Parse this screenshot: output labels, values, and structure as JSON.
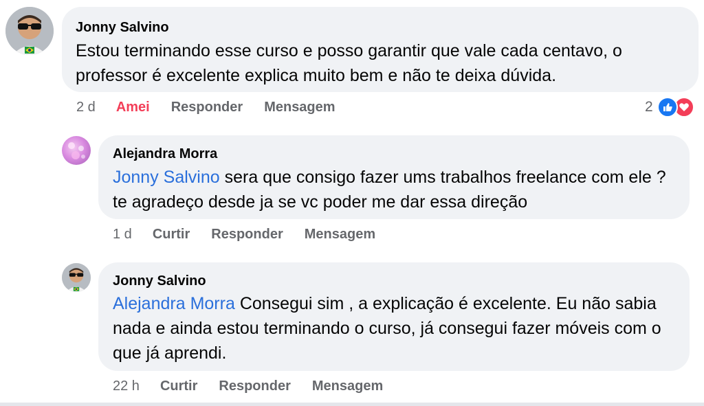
{
  "comments": [
    {
      "author": "Jonny Salvino",
      "text": "Estou terminando esse curso e posso garantir que vale cada centavo, o professor é excelente explica muito bem e não te deixa dúvida.",
      "time": "2 d",
      "reaction_label": "Amei",
      "reply_label": "Responder",
      "message_label": "Mensagem",
      "reaction_count": "2"
    },
    {
      "author": "Alejandra Morra",
      "mention": "Jonny Salvino",
      "text": "sera que consigo fazer ums trabalhos freelance com ele ? te agradeço desde ja se vc poder me dar essa direção",
      "time": "1 d",
      "like_label": "Curtir",
      "reply_label": "Responder",
      "message_label": "Mensagem"
    },
    {
      "author": "Jonny Salvino",
      "mention": "Alejandra Morra",
      "text": "Consegui sim , a explicação é excelente. Eu não sabia nada e ainda estou terminando o curso, já consegui fazer móveis com o que já aprendi.",
      "time": "22 h",
      "like_label": "Curtir",
      "reply_label": "Responder",
      "message_label": "Mensagem"
    }
  ],
  "icons": {
    "like": "thumbs-up-icon",
    "love": "heart-icon"
  },
  "colors": {
    "bubble": "#f0f2f5",
    "mention": "#2a6fdb",
    "love": "#f33e58",
    "like": "#1877f2",
    "meta": "#65676b"
  }
}
